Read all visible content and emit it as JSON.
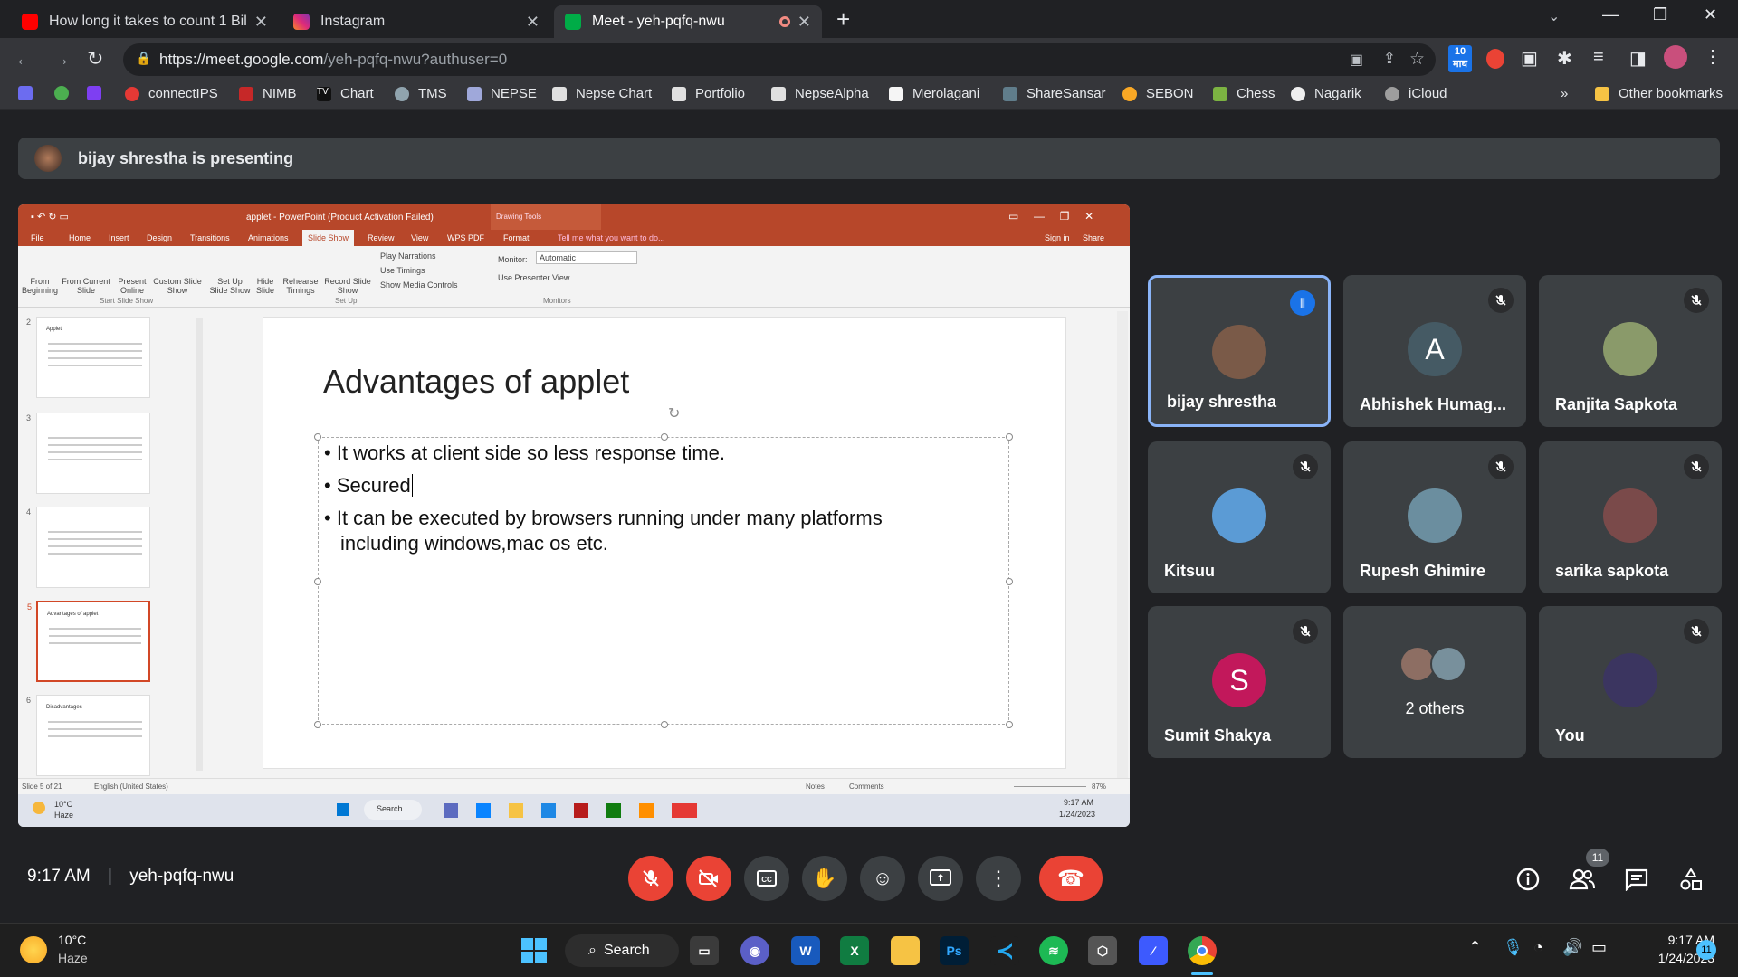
{
  "browser": {
    "tabs": [
      {
        "title": "How long it takes to count 1 Billi",
        "color": "#ff0000"
      },
      {
        "title": "Instagram",
        "color": "#e1306c"
      },
      {
        "title": "Meet - yeh-pqfq-nwu",
        "color": "#00ac47"
      }
    ],
    "url": "https://meet.google.com/yeh-pqfq-nwu?authuser=0",
    "url_host": "https://meet.google.com",
    "url_path": "/yeh-pqfq-nwu?authuser=0",
    "ext_badge": "10",
    "ext_badge_sub": "माघ",
    "bookmarks": [
      "connectIPS",
      "NIMB",
      "Chart",
      "TMS",
      "NEPSE",
      "Nepse Chart",
      "Portfolio",
      "NepseAlpha",
      "Merolagani",
      "ShareSansar",
      "SEBON",
      "Chess",
      "Nagarik",
      "iCloud"
    ],
    "bookmarks_more": "»",
    "other_bookmarks": "Other bookmarks"
  },
  "meet": {
    "presenting_banner": "bijay shrestha is presenting",
    "time": "9:17 AM",
    "meeting_code": "yeh-pqfq-nwu",
    "participant_count": "11",
    "tiles": [
      {
        "name": "bijay shrestha",
        "initial": "",
        "avatar_color": "#7a5a48",
        "speaking": true
      },
      {
        "name": "Abhishek Humag...",
        "initial": "A",
        "avatar_color": "#455a64",
        "speaking": false
      },
      {
        "name": "Ranjita Sapkota",
        "initial": "",
        "avatar_color": "#8a9a6a",
        "speaking": false
      },
      {
        "name": "Kitsuu",
        "initial": "",
        "avatar_color": "#5b9bd5",
        "speaking": false
      },
      {
        "name": "Rupesh Ghimire",
        "initial": "",
        "avatar_color": "#6b8e9f",
        "speaking": false
      },
      {
        "name": "sarika sapkota",
        "initial": "",
        "avatar_color": "#7a4a4a",
        "speaking": false
      },
      {
        "name": "Sumit Shakya",
        "initial": "S",
        "avatar_color": "#c2185b",
        "speaking": false
      },
      {
        "name": "2 others",
        "initial": "",
        "avatar_color": "#5f6368",
        "speaking": false
      },
      {
        "name": "You",
        "initial": "",
        "avatar_color": "#3b3560",
        "speaking": false
      }
    ]
  },
  "ppt": {
    "window_title": "applet - PowerPoint (Product Activation Failed)",
    "drawing_tools": "Drawing Tools",
    "ribbon_tabs": [
      "File",
      "Home",
      "Insert",
      "Design",
      "Transitions",
      "Animations",
      "Slide Show",
      "Review",
      "View",
      "WPS PDF",
      "Format"
    ],
    "active_tab": "Slide Show",
    "tell_me": "Tell me what you want to do...",
    "sign_in": "Sign in",
    "share": "Share",
    "ribbon_buttons": [
      "From Beginning",
      "From Current Slide",
      "Present Online",
      "Custom Slide Show",
      "Set Up Slide Show",
      "Hide Slide",
      "Rehearse Timings",
      "Record Slide Show"
    ],
    "checkboxes": [
      "Play Narrations",
      "Use Timings",
      "Show Media Controls"
    ],
    "monitor_label": "Monitor:",
    "monitor_value": "Automatic",
    "presenter_view": "Use Presenter View",
    "group_labels": [
      "Start Slide Show",
      "Set Up",
      "Monitors"
    ],
    "thumb_titles": [
      "Applet",
      "",
      "",
      "Advantages of applet",
      "Disadvantages"
    ],
    "thumb_numbers": [
      "2",
      "3",
      "4",
      "5",
      "6"
    ],
    "slide_title": "Advantages of applet",
    "bullets": [
      "It works at client side so less response time.",
      "Secured",
      "It can be executed by browsers running under many platforms",
      "including windows,mac os etc."
    ],
    "status_slide": "Slide 5 of 21",
    "status_lang": "English (United States)",
    "status_notes": "Notes",
    "status_comments": "Comments",
    "zoom": "87%",
    "inner_weather_temp": "10°C",
    "inner_weather_desc": "Haze",
    "inner_search": "Search",
    "inner_time": "9:17 AM",
    "inner_date": "1/24/2023"
  },
  "taskbar": {
    "weather_temp": "10°C",
    "weather_desc": "Haze",
    "search": "Search",
    "time": "9:17 AM",
    "date": "1/24/2023",
    "notif_count": "11"
  }
}
